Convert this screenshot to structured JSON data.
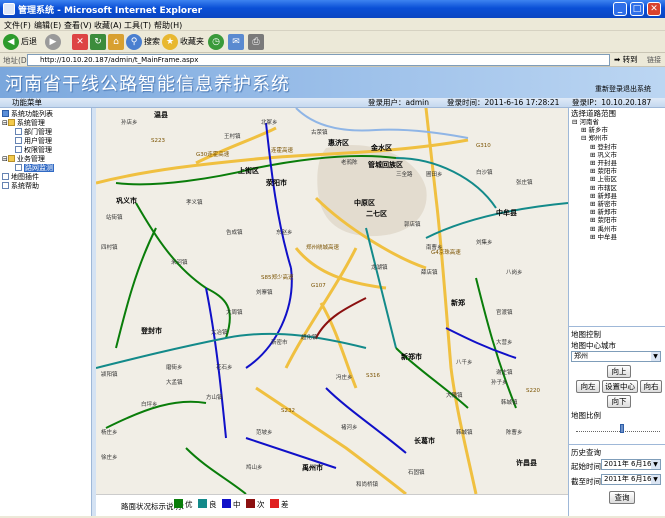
{
  "window": {
    "title": "管理系统 - Microsoft Internet Explorer"
  },
  "menu": [
    "文件(F)",
    "编辑(E)",
    "查看(V)",
    "收藏(A)",
    "工具(T)",
    "帮助(H)"
  ],
  "toolbar": {
    "back": "后退",
    "search": "搜索",
    "favorites": "收藏夹"
  },
  "address": {
    "label": "地址(D)",
    "url": "http://10.10.20.187/admin/t_MainFrame.aspx",
    "go": "转到",
    "links": "链接"
  },
  "banner": {
    "system_title": "河南省干线公路智能信息养护系统",
    "relogin": "重新登录",
    "exit": "退出系统"
  },
  "infobar": {
    "menu_heading": "功能菜单",
    "user": "登录用户：admin",
    "time": "登录时间：2011-6-16 17:28:21",
    "ip": "登录IP：10.10.20.187"
  },
  "sidebar": {
    "items": [
      {
        "label": "系统功能列表",
        "level": 0,
        "icon": "root"
      },
      {
        "label": "系统管理",
        "level": 1,
        "icon": "folder"
      },
      {
        "label": "部门管理",
        "level": 2,
        "icon": "doc"
      },
      {
        "label": "用户管理",
        "level": 2,
        "icon": "doc"
      },
      {
        "label": "权限管理",
        "level": 2,
        "icon": "doc"
      },
      {
        "label": "业务管理",
        "level": 1,
        "icon": "folder"
      },
      {
        "label": "路网监测",
        "level": 2,
        "icon": "doc",
        "selected": true
      },
      {
        "label": "地图插件",
        "level": 1,
        "icon": "doc"
      },
      {
        "label": "系统帮助",
        "level": 1,
        "icon": "doc"
      }
    ]
  },
  "region": {
    "heading": "选择道路范围",
    "items": [
      {
        "label": "河南省",
        "level": 0
      },
      {
        "label": "新乡市",
        "level": 1
      },
      {
        "label": "郑州市",
        "level": 1
      },
      {
        "label": "登封市",
        "level": 2
      },
      {
        "label": "巩义市",
        "level": 2
      },
      {
        "label": "开封县",
        "level": 2
      },
      {
        "label": "荥阳市",
        "level": 2
      },
      {
        "label": "上街区",
        "level": 2
      },
      {
        "label": "市辖区",
        "level": 2
      },
      {
        "label": "新郑县",
        "level": 2
      },
      {
        "label": "新密市",
        "level": 2
      },
      {
        "label": "新郑市",
        "level": 2
      },
      {
        "label": "荥阳市",
        "level": 2
      },
      {
        "label": "禹州市",
        "level": 2
      },
      {
        "label": "中牟县",
        "level": 2
      }
    ]
  },
  "mapcontrol": {
    "heading": "地图控制",
    "center_label": "地图中心城市",
    "center_city": "郑州",
    "up": "向上",
    "left": "向左",
    "center": "设置中心",
    "right": "向右",
    "down": "向下",
    "scale_label": "地图比例",
    "scale_level": 0.55
  },
  "history": {
    "heading": "历史查询",
    "start_label": "起始时间",
    "start": "2011年 6月16日",
    "end_label": "截至时间",
    "end": "2011年 6月16日",
    "query": "查询"
  },
  "legend": {
    "title": "路面状况标示说明：",
    "items": [
      {
        "label": "优",
        "color": "#0a7d0a"
      },
      {
        "label": "良",
        "color": "#138a8a"
      },
      {
        "label": "中",
        "color": "#1010c8"
      },
      {
        "label": "次",
        "color": "#8b1010"
      },
      {
        "label": "差",
        "color": "#e02020"
      }
    ]
  },
  "map": {
    "cities": [
      "温县",
      "惠济区",
      "金水区",
      "管城回族区",
      "中原区",
      "二七区",
      "上街区",
      "荥阳市",
      "巩义市",
      "新郑市",
      "新郑",
      "登封市",
      "禹州市",
      "长葛市",
      "许昌县",
      "中牟县"
    ],
    "places": [
      "孙店乡",
      "王村镇",
      "北冢乡",
      "古荥镇",
      "老鸦陈",
      "三全路",
      "圃田乡",
      "白沙镇",
      "张庄镇",
      "站街镇",
      "孝义镇",
      "米河镇",
      "大周镇",
      "刘寨镇",
      "新密市",
      "超化镇",
      "郭店镇",
      "龙湖镇",
      "薛店镇",
      "大隗镇",
      "告成镇",
      "大冶镇",
      "石固镇",
      "和尚桥镇",
      "大营乡",
      "韩城镇",
      "谢庄镇",
      "八岗乡",
      "官渡镇",
      "八千乡",
      "刘集乡",
      "陈曹乡",
      "冯庄乡",
      "方山镇",
      "花石乡",
      "范坡乡",
      "褚河乡",
      "鸠山乡",
      "杨庄乡",
      "颍阳镇",
      "白坪乡",
      "磨街乡",
      "徐庄乡",
      "韩城镇",
      "东赵乡",
      "孙子乡",
      "南曹乡",
      "四村镇",
      "大孟镇"
    ],
    "roads": [
      "G30连霍高速",
      "连霍高速",
      "G4京珠高速",
      "郑州绕城高速",
      "S85郑少高速",
      "G107",
      "S316",
      "S232",
      "S223",
      "S220",
      "G310"
    ]
  }
}
